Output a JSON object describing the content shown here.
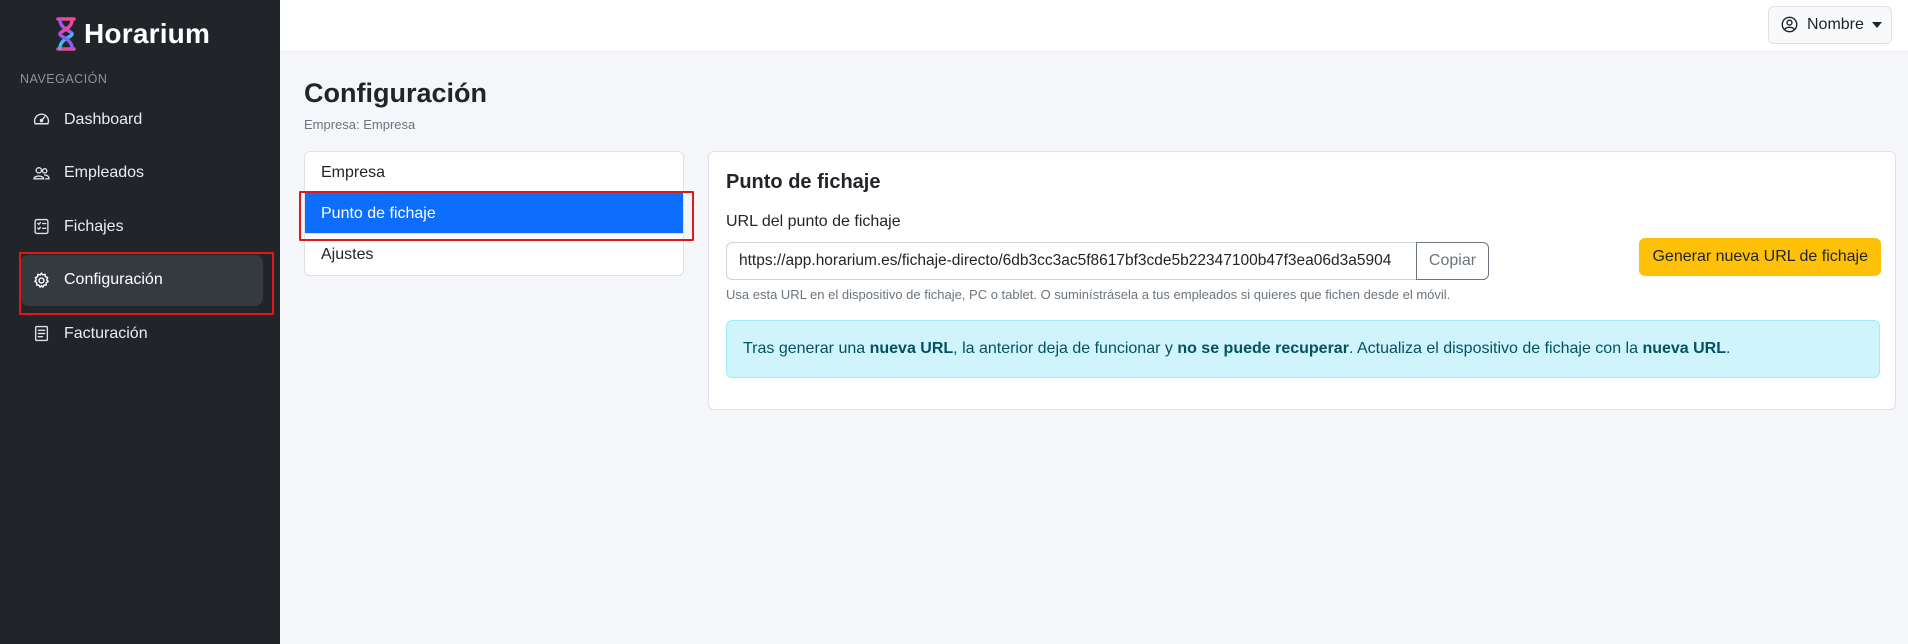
{
  "brand": {
    "name": "Horarium",
    "logo_colors": [
      "#ec4899",
      "#8b5cf6",
      "#38bdf8"
    ]
  },
  "sidebar": {
    "heading": "NAVEGACIÓN",
    "items": [
      {
        "label": "Dashboard",
        "icon": "speedometer-icon",
        "active": false
      },
      {
        "label": "Empleados",
        "icon": "people-icon",
        "active": false
      },
      {
        "label": "Fichajes",
        "icon": "list-check-icon",
        "active": false
      },
      {
        "label": "Configuración",
        "icon": "gear-icon",
        "active": true
      },
      {
        "label": "Facturación",
        "icon": "receipt-icon",
        "active": false
      }
    ]
  },
  "topbar": {
    "user_label": "Nombre",
    "user_icon": "person-circle-icon"
  },
  "page": {
    "title": "Configuración",
    "subtitle": "Empresa: Empresa"
  },
  "settings_menu": {
    "items": [
      {
        "label": "Empresa",
        "active": false
      },
      {
        "label": "Punto de fichaje",
        "active": true
      },
      {
        "label": "Ajustes",
        "active": false
      }
    ]
  },
  "card": {
    "title": "Punto de fichaje",
    "url_label": "URL del punto de fichaje",
    "url_value": "https://app.horarium.es/fichaje-directo/6db3cc3ac5f8617bf3cde5b22347100b47f3ea06d3a5904",
    "copy_label": "Copiar",
    "help_text": "Usa esta URL en el dispositivo de fichaje, PC o tablet. O suminístrásela a tus empleados si quieres que fichen desde el móvil.",
    "generate_label": "Generar nueva URL de fichaje",
    "alert": {
      "part1": "Tras generar una ",
      "bold1": "nueva URL",
      "part2": ", la anterior deja de funcionar y ",
      "bold2": "no se puede recuperar",
      "part3": ". Actualiza el dispositivo de fichaje con la ",
      "bold3": "nueva URL",
      "part4": "."
    }
  },
  "colors": {
    "sidebar_bg": "#212529",
    "primary": "#0d6efd",
    "warning": "#ffc107",
    "info_bg": "#cff4fc",
    "highlight": "#e01818"
  }
}
